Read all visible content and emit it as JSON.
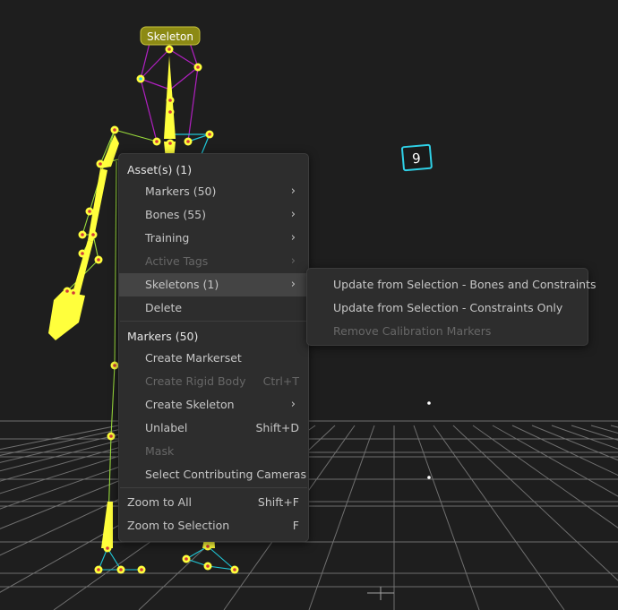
{
  "viewport": {
    "skeleton_label": "Skeleton",
    "camera_number": "9"
  },
  "context_menu": {
    "assets_header": "Asset(s) (1)",
    "markers_item": "Markers (50)",
    "bones_item": "Bones (55)",
    "training_item": "Training",
    "active_tags_item": "Active Tags",
    "skeletons_item": "Skeletons (1)",
    "delete_item": "Delete",
    "markers_header": "Markers (50)",
    "create_markerset": "Create Markerset",
    "create_rigid_body": "Create Rigid Body",
    "create_rigid_body_shortcut": "Ctrl+T",
    "create_skeleton": "Create Skeleton",
    "unlabel": "Unlabel",
    "unlabel_shortcut": "Shift+D",
    "mask": "Mask",
    "select_contributing_cameras": "Select Contributing Cameras",
    "zoom_to_all": "Zoom to All",
    "zoom_to_all_shortcut": "Shift+F",
    "zoom_to_selection": "Zoom to Selection",
    "zoom_to_selection_shortcut": "F"
  },
  "skeletons_submenu": {
    "update_bones_constraints": "Update from Selection - Bones and Constraints",
    "update_constraints_only": "Update from Selection - Constraints Only",
    "remove_calibration_markers": "Remove Calibration Markers"
  },
  "colors": {
    "viewport_bg": "#1e1e1e",
    "grid": "#8a8a8a",
    "skeleton_yellow": "#ffff3c",
    "bone_purple": "#b020c0",
    "bone_cyan": "#20c8d8",
    "bone_green": "#9adc3c",
    "menu_bg": "#2d2d2d",
    "menu_highlight": "#444444"
  }
}
